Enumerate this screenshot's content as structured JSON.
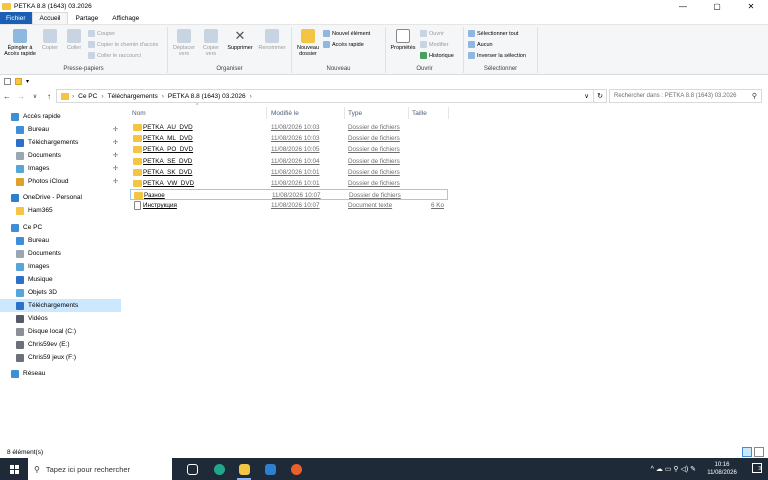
{
  "window": {
    "title": "PETKA 8.8 (1643) 03.2026"
  },
  "window_buttons": {
    "minimize": "—",
    "maximize": "▢",
    "close": "✕"
  },
  "ribbon_tabs": [
    {
      "label": "Fichier"
    },
    {
      "label": "Accueil"
    },
    {
      "label": "Partage"
    },
    {
      "label": "Affichage"
    }
  ],
  "ribbon": {
    "clipboard": {
      "pin": "Épingler à Accès rapide",
      "copy": "Copier",
      "paste": "Coller",
      "cut": "Couper",
      "copy_path": "Copier le chemin d'accès",
      "paste_shortcut": "Coller le raccourci",
      "label": "Presse-papiers"
    },
    "organize": {
      "move": "Déplacer vers",
      "copy_to": "Copier vers",
      "delete": "Supprimer",
      "rename": "Renommer",
      "label": "Organiser"
    },
    "new": {
      "new_folder": "Nouveau dossier",
      "new_item": "Nouvel élément",
      "quick_access": "Accès rapide",
      "label": "Nouveau"
    },
    "open": {
      "properties": "Propriétés",
      "open": "Ouvrir",
      "edit": "Modifier",
      "history": "Historique",
      "label": "Ouvrir"
    },
    "select": {
      "select_all": "Sélectionner tout",
      "select_none": "Aucun",
      "invert": "Inverser la sélection",
      "label": "Sélectionner"
    }
  },
  "address": {
    "crumbs": [
      "Ce PC",
      "Téléchargements",
      "PETKA 8.8 (1643) 03.2026"
    ],
    "search_placeholder": "Rechercher dans : PETKA 8.8 (1643) 03.2026"
  },
  "nav": [
    {
      "label": "Accès rapide",
      "icon": "star-icon",
      "color": "#3e8ed8",
      "indent": 0
    },
    {
      "label": "Bureau",
      "icon": "desktop-icon",
      "color": "#3e8ed8",
      "indent": 1,
      "pinned": true
    },
    {
      "label": "Téléchargements",
      "icon": "download-icon",
      "color": "#2d6fc9",
      "indent": 1,
      "pinned": true
    },
    {
      "label": "Documents",
      "icon": "documents-icon",
      "color": "#9aa6b2",
      "indent": 1,
      "pinned": true
    },
    {
      "label": "Images",
      "icon": "pictures-icon",
      "color": "#58a6d8",
      "indent": 1,
      "pinned": true
    },
    {
      "label": "Photos iCloud",
      "icon": "icloud-photos-icon",
      "color": "#e0a030",
      "indent": 1,
      "pinned": true
    },
    {
      "label": "OneDrive - Personal",
      "icon": "cloud-icon",
      "color": "#2f7fd0",
      "indent": 0
    },
    {
      "label": "Ham365",
      "icon": "folder-icon",
      "color": "#f4c542",
      "indent": 1
    },
    {
      "label": "Ce PC",
      "icon": "computer-icon",
      "color": "#3e8ed8",
      "indent": 0
    },
    {
      "label": "Bureau",
      "icon": "desktop-icon",
      "color": "#3e8ed8",
      "indent": 1
    },
    {
      "label": "Documents",
      "icon": "documents-icon",
      "color": "#9aa6b2",
      "indent": 1
    },
    {
      "label": "Images",
      "icon": "pictures-icon",
      "color": "#58a6d8",
      "indent": 1
    },
    {
      "label": "Musique",
      "icon": "music-icon",
      "color": "#2d6fc9",
      "indent": 1
    },
    {
      "label": "Objets 3D",
      "icon": "cube-icon",
      "color": "#58a6d8",
      "indent": 1
    },
    {
      "label": "Téléchargements",
      "icon": "download-icon",
      "color": "#2d6fc9",
      "indent": 1,
      "selected": true
    },
    {
      "label": "Vidéos",
      "icon": "video-icon",
      "color": "#555a66",
      "indent": 1
    },
    {
      "label": "Disque local (C:)",
      "icon": "drive-icon",
      "color": "#8a8f98",
      "indent": 1
    },
    {
      "label": "Chris59ev  (E:)",
      "icon": "drive-icon",
      "color": "#6b7079",
      "indent": 1
    },
    {
      "label": "Chris59 jeux (F:)",
      "icon": "drive-icon",
      "color": "#6b7079",
      "indent": 1
    },
    {
      "label": "Réseau",
      "icon": "network-icon",
      "color": "#3e8ed8",
      "indent": 0
    }
  ],
  "columns": {
    "name": "Nom",
    "modified": "Modifié le",
    "type": "Type",
    "size": "Taille"
  },
  "files": [
    {
      "name": "PETKA_AU_DVD",
      "modified": "11/08/2026 10:03",
      "type": "Dossier de fichiers",
      "size": "",
      "kind": "folder"
    },
    {
      "name": "PETKA_ML_DVD",
      "modified": "11/08/2026 10:03",
      "type": "Dossier de fichiers",
      "size": "",
      "kind": "folder"
    },
    {
      "name": "PETKA_PO_DVD",
      "modified": "11/08/2026 10:05",
      "type": "Dossier de fichiers",
      "size": "",
      "kind": "folder"
    },
    {
      "name": "PETKA_SE_DVD",
      "modified": "11/08/2026 10:04",
      "type": "Dossier de fichiers",
      "size": "",
      "kind": "folder"
    },
    {
      "name": "PETKA_SK_DVD",
      "modified": "11/08/2026 10:01",
      "type": "Dossier de fichiers",
      "size": "",
      "kind": "folder"
    },
    {
      "name": "PETKA_VW_DVD",
      "modified": "11/08/2026 10:01",
      "type": "Dossier de fichiers",
      "size": "",
      "kind": "folder"
    },
    {
      "name": "Разное",
      "modified": "11/08/2026 10:07",
      "type": "Dossier de fichiers",
      "size": "",
      "kind": "folder",
      "focused": true
    },
    {
      "name": "Инструкция",
      "modified": "11/08/2026 10:07",
      "type": "Document texte",
      "size": "6 Ko",
      "kind": "text"
    }
  ],
  "status": {
    "count": "8 élément(s)"
  },
  "taskbar": {
    "search_placeholder": "Tapez ici pour rechercher",
    "apps": [
      {
        "icon": "task-view-icon",
        "color": "#ffffff"
      },
      {
        "icon": "edge-icon",
        "color": "#1fa88a"
      },
      {
        "icon": "file-explorer-icon",
        "color": "#f4c542",
        "active": true
      },
      {
        "icon": "mail-icon",
        "color": "#2f7fd0"
      },
      {
        "icon": "firefox-icon",
        "color": "#e8602c"
      }
    ],
    "time": "10:16",
    "date": "11/08/2026",
    "tray_icons": "^  ☁  ▭  ⚲  ◁)  ✎"
  }
}
